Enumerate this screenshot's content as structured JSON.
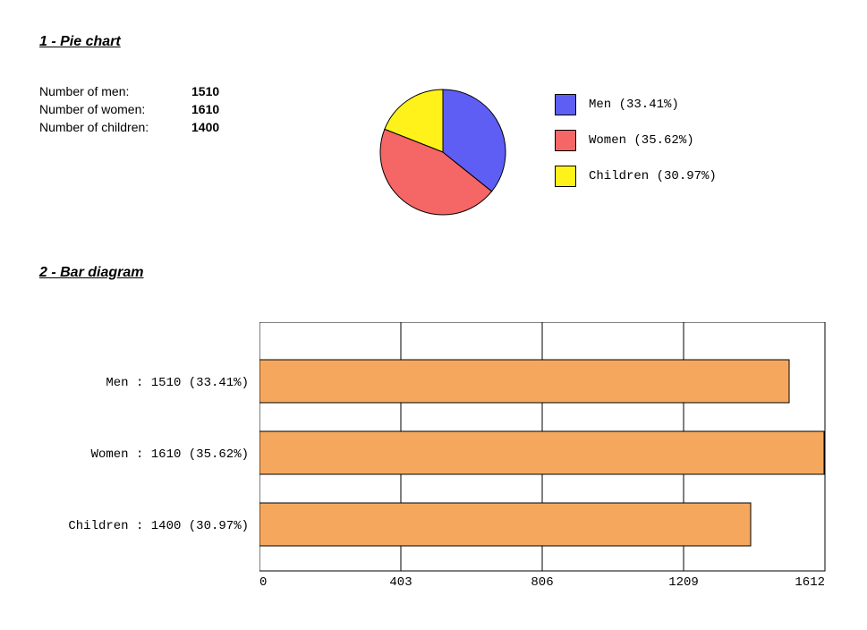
{
  "headings": {
    "pie": "1 - Pie chart",
    "bar": "2 - Bar diagram"
  },
  "data_rows": [
    {
      "label": "Number of men:",
      "value": "1510"
    },
    {
      "label": "Number of women:",
      "value": "1610"
    },
    {
      "label": "Number of children:",
      "value": "1400"
    }
  ],
  "legend": [
    {
      "text": "Men (33.41%)",
      "color": "#5e5ef5"
    },
    {
      "text": "Women (35.62%)",
      "color": "#f56666"
    },
    {
      "text": "Children (30.97%)",
      "color": "#fff21a"
    }
  ],
  "bar_labels": [
    "Men : 1510 (33.41%)",
    "Women : 1610 (35.62%)",
    "Children : 1400 (30.97%)"
  ],
  "bar_ticks": [
    "0",
    "403",
    "806",
    "1209",
    "1612"
  ],
  "chart_data": [
    {
      "type": "pie",
      "title": "",
      "series": [
        {
          "name": "Men",
          "value": 1510,
          "percent": 33.41,
          "color": "#5e5ef5"
        },
        {
          "name": "Women",
          "value": 1610,
          "percent": 35.62,
          "color": "#f56666"
        },
        {
          "name": "Children",
          "value": 1400,
          "percent": 30.97,
          "color": "#fff21a"
        }
      ]
    },
    {
      "type": "bar",
      "orientation": "horizontal",
      "categories": [
        "Men",
        "Women",
        "Children"
      ],
      "values": [
        1510,
        1610,
        1400
      ],
      "percents": [
        33.41,
        35.62,
        30.97
      ],
      "bar_color": "#f5a85d",
      "xlabel": "",
      "ylabel": "",
      "xlim": [
        0,
        1612
      ],
      "xticks": [
        0,
        403,
        806,
        1209,
        1612
      ]
    }
  ]
}
